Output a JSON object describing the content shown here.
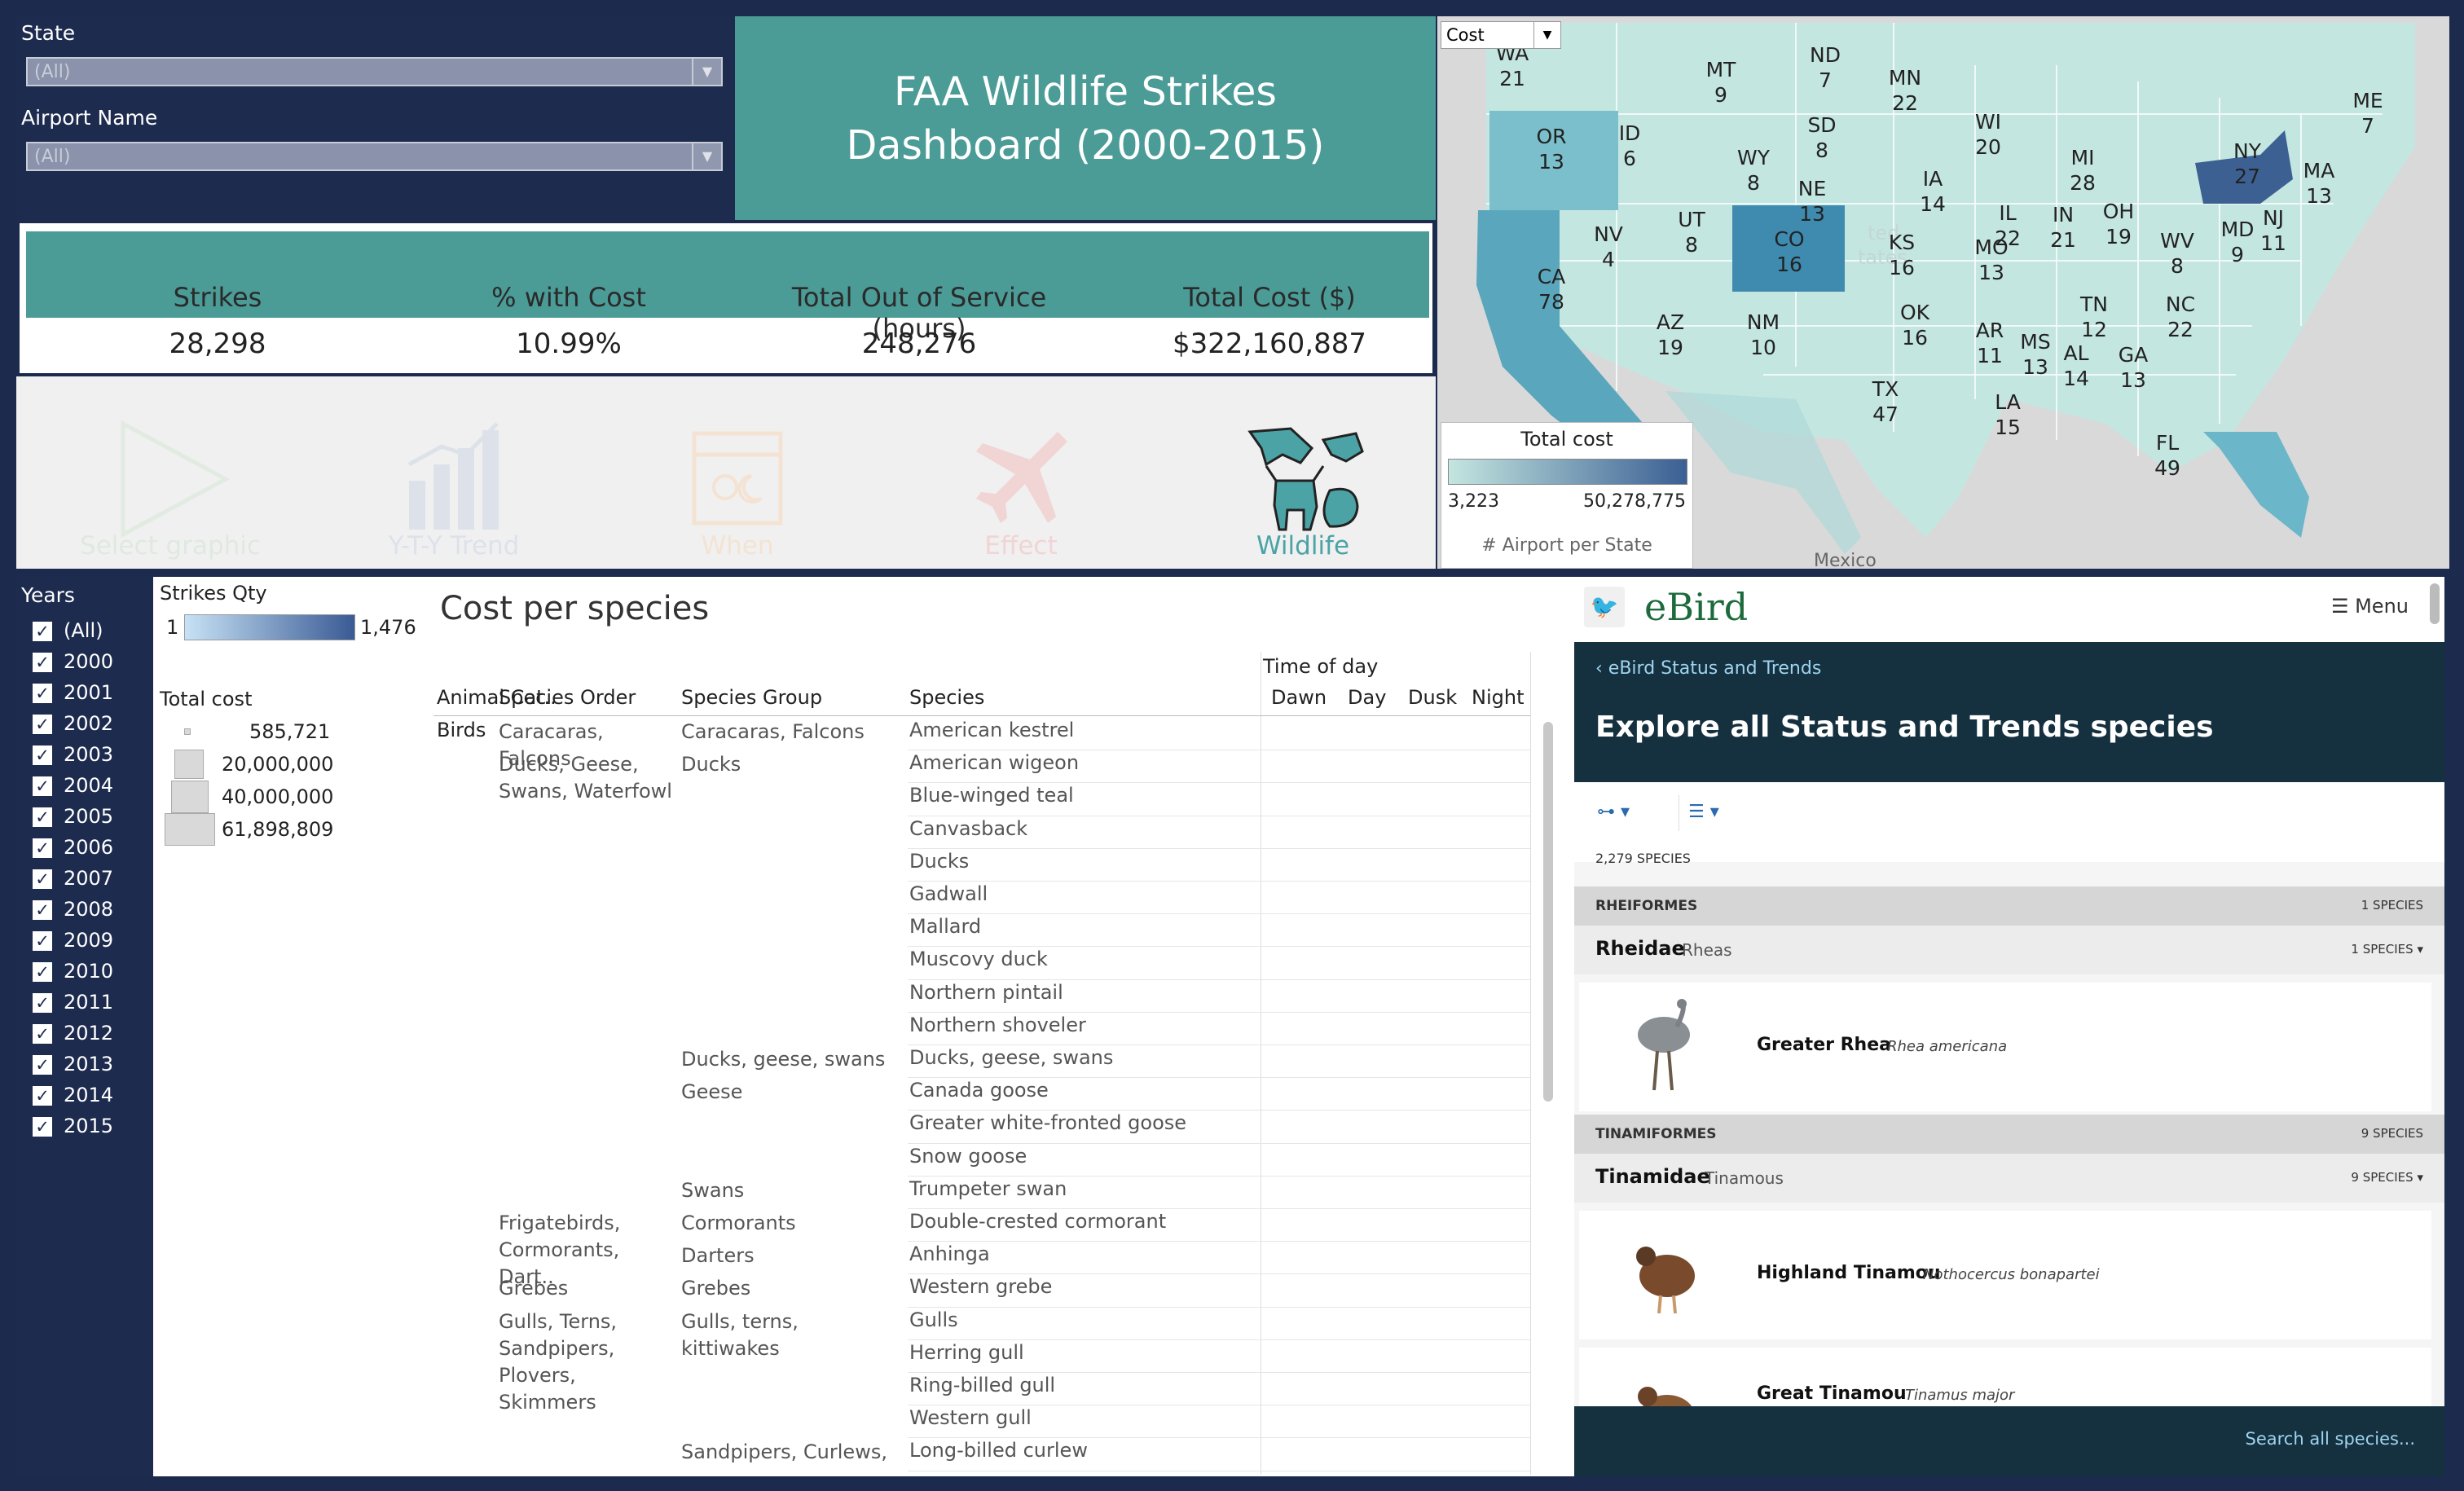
{
  "filters": {
    "state_label": "State",
    "state_value": "(All)",
    "airport_label": "Airport Name",
    "airport_value": "(All)"
  },
  "dashboard_title": "FAA Wildlife Strikes Dashboard (2000-2015)",
  "kpis": [
    {
      "label": "Strikes",
      "value": "28,298"
    },
    {
      "label": "% with Cost",
      "value": "10.99%"
    },
    {
      "label": "Total Out of Service (hours)",
      "value": "248,276"
    },
    {
      "label": "Total Cost ($)",
      "value": "$322,160,887"
    }
  ],
  "graphic_buttons": [
    {
      "label": "Select graphic",
      "icon": "play-icon",
      "color": "#e3ece3"
    },
    {
      "label": "Y-T-Y Trend",
      "icon": "bar-chart-icon",
      "color": "#dde2ea"
    },
    {
      "label": "When",
      "icon": "calendar-icon",
      "color": "#f4e3d2"
    },
    {
      "label": "Effect",
      "icon": "airplane-icon",
      "color": "#f1d4d4"
    },
    {
      "label": "Wildlife",
      "icon": "wildlife-icon",
      "color": "#4ba3a6"
    }
  ],
  "map": {
    "selector_value": "Cost",
    "background_labels": [
      "ted",
      "tates",
      "Mexico"
    ],
    "states": [
      {
        "abbr": "WA",
        "count": "21"
      },
      {
        "abbr": "MT",
        "count": "9"
      },
      {
        "abbr": "ND",
        "count": "7"
      },
      {
        "abbr": "MN",
        "count": "22"
      },
      {
        "abbr": "ME",
        "count": "7"
      },
      {
        "abbr": "OR",
        "count": "13"
      },
      {
        "abbr": "ID",
        "count": "6"
      },
      {
        "abbr": "SD",
        "count": "8"
      },
      {
        "abbr": "WI",
        "count": "20"
      },
      {
        "abbr": "WY",
        "count": "8"
      },
      {
        "abbr": "MI",
        "count": "28"
      },
      {
        "abbr": "NY",
        "count": "27"
      },
      {
        "abbr": "MA",
        "count": "13"
      },
      {
        "abbr": "IA",
        "count": "14"
      },
      {
        "abbr": "NE",
        "count": "13"
      },
      {
        "abbr": "NV",
        "count": "4"
      },
      {
        "abbr": "UT",
        "count": "8"
      },
      {
        "abbr": "CO",
        "count": "16"
      },
      {
        "abbr": "IL",
        "count": "22"
      },
      {
        "abbr": "IN",
        "count": "21"
      },
      {
        "abbr": "OH",
        "count": "19"
      },
      {
        "abbr": "MD",
        "count": "9"
      },
      {
        "abbr": "NJ",
        "count": "11"
      },
      {
        "abbr": "CA",
        "count": "78"
      },
      {
        "abbr": "KS",
        "count": "16"
      },
      {
        "abbr": "MO",
        "count": "13"
      },
      {
        "abbr": "WV",
        "count": "8"
      },
      {
        "abbr": "AZ",
        "count": "19"
      },
      {
        "abbr": "NM",
        "count": "10"
      },
      {
        "abbr": "OK",
        "count": "16"
      },
      {
        "abbr": "TN",
        "count": "12"
      },
      {
        "abbr": "NC",
        "count": "22"
      },
      {
        "abbr": "AR",
        "count": "11"
      },
      {
        "abbr": "MS",
        "count": "13"
      },
      {
        "abbr": "AL",
        "count": "14"
      },
      {
        "abbr": "GA",
        "count": "13"
      },
      {
        "abbr": "TX",
        "count": "47"
      },
      {
        "abbr": "LA",
        "count": "15"
      },
      {
        "abbr": "FL",
        "count": "49"
      }
    ],
    "legend_title": "Total cost",
    "legend_min": "3,223",
    "legend_max": "50,278,775",
    "legend_caption": "# Airport per State",
    "color_low": "#c4e6e0",
    "color_high": "#3a5f93"
  },
  "years": {
    "title": "Years",
    "items": [
      "(All)",
      "2000",
      "2001",
      "2002",
      "2003",
      "2004",
      "2005",
      "2006",
      "2007",
      "2008",
      "2009",
      "2010",
      "2011",
      "2012",
      "2013",
      "2014",
      "2015"
    ]
  },
  "legend": {
    "strikes_title": "Strikes Qty",
    "strikes_min": "1",
    "strikes_max": "1,476",
    "cost_title": "Total cost",
    "cost_items": [
      "585,721",
      "20,000,000",
      "40,000,000",
      "61,898,809"
    ]
  },
  "table": {
    "title": "Cost per species",
    "time_of_day_header": "Time of day",
    "columns": [
      "Animal Cat..",
      "Species Order",
      "Species Group",
      "Species",
      "Dawn",
      "Day",
      "Dusk",
      "Night"
    ],
    "animal_category": "Birds",
    "rows": [
      {
        "order": "Caracaras, Falcons",
        "group": "Caracaras, Falcons",
        "species": "American kestrel"
      },
      {
        "order": "Ducks, Geese, Swans, Waterfowl",
        "group": "Ducks",
        "species": "American wigeon"
      },
      {
        "order": "",
        "group": "",
        "species": "Blue-winged teal"
      },
      {
        "order": "",
        "group": "",
        "species": "Canvasback"
      },
      {
        "order": "",
        "group": "",
        "species": "Ducks"
      },
      {
        "order": "",
        "group": "",
        "species": "Gadwall"
      },
      {
        "order": "",
        "group": "",
        "species": "Mallard"
      },
      {
        "order": "",
        "group": "",
        "species": "Muscovy duck"
      },
      {
        "order": "",
        "group": "",
        "species": "Northern pintail"
      },
      {
        "order": "",
        "group": "",
        "species": "Northern shoveler"
      },
      {
        "order": "",
        "group": "Ducks, geese, swans",
        "species": "Ducks, geese, swans"
      },
      {
        "order": "",
        "group": "Geese",
        "species": "Canada goose"
      },
      {
        "order": "",
        "group": "",
        "species": "Greater white-fronted goose"
      },
      {
        "order": "",
        "group": "",
        "species": "Snow goose"
      },
      {
        "order": "",
        "group": "Swans",
        "species": "Trumpeter swan"
      },
      {
        "order": "Frigatebirds, Cormorants, Dart..",
        "group": "Cormorants",
        "species": "Double-crested cormorant"
      },
      {
        "order": "",
        "group": "Darters",
        "species": "Anhinga"
      },
      {
        "order": "Grebes",
        "group": "Grebes",
        "species": "Western grebe"
      },
      {
        "order": "Gulls, Terns, Sandpipers, Plovers, Skimmers",
        "group": "Gulls, terns, kittiwakes",
        "species": "Gulls"
      },
      {
        "order": "",
        "group": "",
        "species": "Herring gull"
      },
      {
        "order": "",
        "group": "",
        "species": "Ring-billed gull"
      },
      {
        "order": "",
        "group": "",
        "species": "Western gull"
      },
      {
        "order": "",
        "group": "Sandpipers, Curlews, ..",
        "species": "Long-billed curlew"
      }
    ]
  },
  "ebird": {
    "logo_text": "eBird",
    "menu_label": "Menu",
    "back_link": "eBird Status and Trends",
    "heading": "Explore all Status and Trends species",
    "species_count": "2,279 SPECIES",
    "orders": [
      {
        "order": "RHEIFORMES",
        "order_count": "1 SPECIES",
        "family": "Rheidae",
        "family_common": "Rheas",
        "family_count": "1 SPECIES",
        "species": [
          {
            "common": "Greater Rhea",
            "scientific": "Rhea americana"
          }
        ]
      },
      {
        "order": "TINAMIFORMES",
        "order_count": "9 SPECIES",
        "family": "Tinamidae",
        "family_common": "Tinamous",
        "family_count": "9 SPECIES",
        "species": [
          {
            "common": "Highland Tinamou",
            "scientific": "Nothocercus bonapartei"
          },
          {
            "common": "Great Tinamou",
            "scientific": "Tinamus major"
          }
        ]
      }
    ],
    "search_link": "Search all species..."
  }
}
